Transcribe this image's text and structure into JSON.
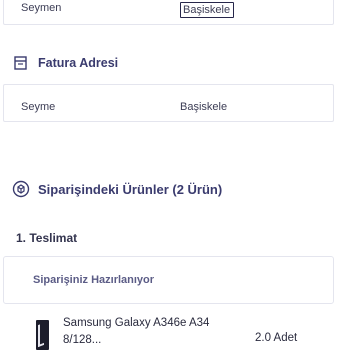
{
  "top_row": {
    "left": "Seymen",
    "right": "Başiskele"
  },
  "invoice_address": {
    "icon": "invoice-address-icon",
    "title": "Fatura Adresi",
    "left": "Seyme",
    "right": "Başiskele"
  },
  "order_items": {
    "icon": "box-icon",
    "title": "Siparişindeki Ürünler (2 Ürün)"
  },
  "shipment": {
    "title": "1. Teslimat",
    "status": "Siparişiniz Hazırlanıyor"
  },
  "product": {
    "name": "Samsung Galaxy A346e A34 8/128...",
    "quantity": "2.0 Adet"
  },
  "colors": {
    "accent": "#3a3b6e",
    "border": "#e4e5ee"
  }
}
